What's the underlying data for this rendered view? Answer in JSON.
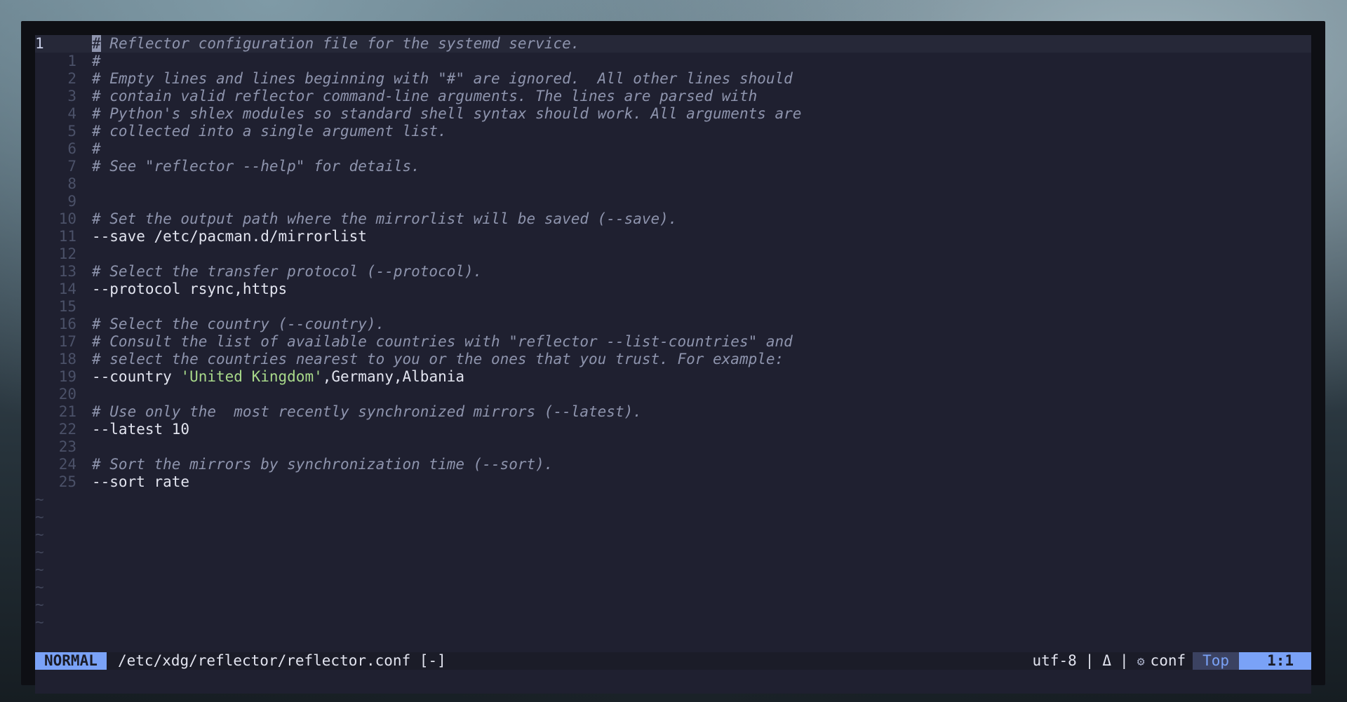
{
  "editor": {
    "lines": [
      {
        "num": "1",
        "current": true,
        "segments": [
          {
            "t": "cursor",
            "text": "#"
          },
          {
            "t": "comment",
            "text": " Reflector configuration file for the systemd service."
          }
        ]
      },
      {
        "num": "1",
        "segments": [
          {
            "t": "comment",
            "text": "#"
          }
        ]
      },
      {
        "num": "2",
        "segments": [
          {
            "t": "comment",
            "text": "# Empty lines and lines beginning with \"#\" are ignored.  All other lines should"
          }
        ]
      },
      {
        "num": "3",
        "segments": [
          {
            "t": "comment",
            "text": "# contain valid reflector command-line arguments. The lines are parsed with"
          }
        ]
      },
      {
        "num": "4",
        "segments": [
          {
            "t": "comment",
            "text": "# Python's shlex modules so standard shell syntax should work. All arguments are"
          }
        ]
      },
      {
        "num": "5",
        "segments": [
          {
            "t": "comment",
            "text": "# collected into a single argument list."
          }
        ]
      },
      {
        "num": "6",
        "segments": [
          {
            "t": "comment",
            "text": "#"
          }
        ]
      },
      {
        "num": "7",
        "segments": [
          {
            "t": "comment",
            "text": "# See \"reflector --help\" for details."
          }
        ]
      },
      {
        "num": "8",
        "segments": []
      },
      {
        "num": "9",
        "segments": []
      },
      {
        "num": "10",
        "segments": [
          {
            "t": "comment",
            "text": "# Set the output path where the mirrorlist will be saved (--save)."
          }
        ]
      },
      {
        "num": "11",
        "segments": [
          {
            "t": "plain",
            "text": "--save /etc/pacman.d/mirrorlist"
          }
        ]
      },
      {
        "num": "12",
        "segments": []
      },
      {
        "num": "13",
        "segments": [
          {
            "t": "comment",
            "text": "# Select the transfer protocol (--protocol)."
          }
        ]
      },
      {
        "num": "14",
        "segments": [
          {
            "t": "plain",
            "text": "--protocol rsync,https"
          }
        ]
      },
      {
        "num": "15",
        "segments": []
      },
      {
        "num": "16",
        "segments": [
          {
            "t": "comment",
            "text": "# Select the country (--country)."
          }
        ]
      },
      {
        "num": "17",
        "segments": [
          {
            "t": "comment",
            "text": "# Consult the list of available countries with \"reflector --list-countries\" and"
          }
        ]
      },
      {
        "num": "18",
        "segments": [
          {
            "t": "comment",
            "text": "# select the countries nearest to you or the ones that you trust. For example:"
          }
        ]
      },
      {
        "num": "19",
        "segments": [
          {
            "t": "plain",
            "text": "--country "
          },
          {
            "t": "string",
            "text": "'United Kingdom'"
          },
          {
            "t": "plain",
            "text": ",Germany,Albania"
          }
        ]
      },
      {
        "num": "20",
        "segments": []
      },
      {
        "num": "21",
        "segments": [
          {
            "t": "comment",
            "text": "# Use only the  most recently synchronized mirrors (--latest)."
          }
        ]
      },
      {
        "num": "22",
        "segments": [
          {
            "t": "plain",
            "text": "--latest 10"
          }
        ]
      },
      {
        "num": "23",
        "segments": []
      },
      {
        "num": "24",
        "segments": [
          {
            "t": "comment",
            "text": "# Sort the mirrors by synchronization time (--sort)."
          }
        ]
      },
      {
        "num": "25",
        "segments": [
          {
            "t": "plain",
            "text": "--sort rate"
          }
        ]
      }
    ],
    "empty_marker": "~",
    "empty_marker_count": 8
  },
  "statusline": {
    "mode": "NORMAL",
    "filepath": "/etc/xdg/reflector/reflector.conf [-]",
    "encoding": "utf-8",
    "os_icon": "tux-icon",
    "os_glyph": "Δ",
    "filetype_icon": "gear-icon",
    "filetype_glyph": "⚙",
    "filetype": "conf",
    "progress": "Top",
    "location": "1:1"
  },
  "colors": {
    "background": "#1f2030",
    "mode_accent": "#7aa2f7",
    "comment": "#8e94ad",
    "string": "#a8d98a"
  }
}
